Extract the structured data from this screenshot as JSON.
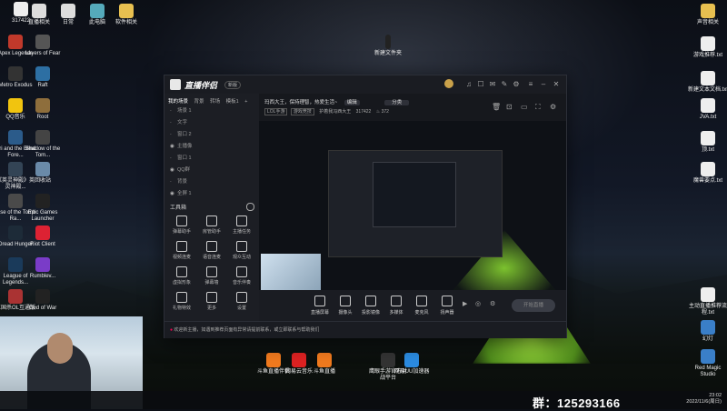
{
  "desktop": {
    "top_left_number": "317422",
    "left_icons": [
      {
        "label": "Apex Legends",
        "color": "#c0392b"
      },
      {
        "label": "Layers of Fear",
        "color": "#555"
      },
      {
        "label": "Metro Exodus",
        "color": "#333"
      },
      {
        "label": "Raft",
        "color": "#2d6fa3"
      },
      {
        "label": "QQ音乐",
        "color": "#f1c40f"
      },
      {
        "label": "Root",
        "color": "#8e6e3c"
      },
      {
        "label": "Ori and the Blind Fore...",
        "color": "#2b5b8a"
      },
      {
        "label": "Shadow of the Tom...",
        "color": "#444"
      },
      {
        "label": "《英灵神殿》英灵神殿...",
        "color": "#345"
      },
      {
        "label": "回收站",
        "color": "#6a8aa8"
      },
      {
        "label": "Rise of the Tomb Ra...",
        "color": "#4a4a4a"
      },
      {
        "label": "Epic Games Launcher",
        "color": "#222"
      },
      {
        "label": "Dread Hunger",
        "color": "#1d2b38"
      },
      {
        "label": "Riot Client",
        "color": "#d23"
      },
      {
        "label": "League of Legends...",
        "color": "#1a3a5a"
      },
      {
        "label": "Rumblev...",
        "color": "#7a3cc8"
      },
      {
        "label": "三国杀OL互通版",
        "color": "#a33"
      },
      {
        "label": "God of War",
        "color": "#222"
      }
    ],
    "top_icons": [
      {
        "label": "直播相关",
        "color": "#ddd"
      },
      {
        "label": "日常",
        "color": "#ddd"
      },
      {
        "label": "此电脑",
        "color": "#5ab"
      },
      {
        "label": "软件相关",
        "color": "#e8c050"
      }
    ],
    "top_center_label": "新建文件夹",
    "right_icons": [
      {
        "label": "声音相关",
        "color": "#e8c050"
      },
      {
        "label": "游戏推荐.txt",
        "color": "#eee"
      },
      {
        "label": "新建文本文档.txt",
        "color": "#eee"
      },
      {
        "label": "JVA.txt",
        "color": "#eee"
      },
      {
        "label": "顶.txt",
        "color": "#eee"
      },
      {
        "label": "魔兽要点.txt",
        "color": "#eee"
      },
      {
        "label": "主动直播推荐流程.txt",
        "color": "#eee"
      },
      {
        "label": "幻灯",
        "color": "#3a7fc8"
      },
      {
        "label": "Red Magic Studio",
        "color": "#3a7fc8"
      }
    ],
    "bottom_icons": [
      {
        "label": "斗鱼直播伴侣",
        "color": "#f07a1e"
      },
      {
        "label": "网易云音乐",
        "color": "#d22"
      },
      {
        "label": "斗鱼直播",
        "color": "#f07a1e"
      },
      {
        "label": "鹰眼手游官方对战平台",
        "color": "#333"
      },
      {
        "label": "网易UU加速器",
        "color": "#2b8be0"
      }
    ]
  },
  "app": {
    "title": "直播伴侣",
    "badge": "新版",
    "sidebar_tabs": [
      "我的场景",
      "背景",
      "转场",
      "模板1"
    ],
    "scenes": [
      {
        "label": "场景 1",
        "visible": false
      },
      {
        "label": "文字",
        "visible": false
      },
      {
        "label": "窗口 2",
        "visible": false
      },
      {
        "label": "主播像",
        "visible": true
      },
      {
        "label": "窗口 1",
        "visible": false
      },
      {
        "label": "QQ群",
        "visible": true
      },
      {
        "label": "背景",
        "visible": false
      },
      {
        "label": "全屏 1",
        "visible": true
      }
    ],
    "tools_title": "工具箱",
    "tools": [
      {
        "label": "弹幕助手"
      },
      {
        "label": "房管助手"
      },
      {
        "label": "主播任务"
      },
      {
        "label": "视频连麦"
      },
      {
        "label": "语音连麦"
      },
      {
        "label": "观众互动"
      },
      {
        "label": "虚拟形象"
      },
      {
        "label": "弹幕墙"
      },
      {
        "label": "音乐伴奏"
      },
      {
        "label": "礼物特效"
      },
      {
        "label": "更多"
      },
      {
        "label": "设置"
      }
    ],
    "header_room": "玛西大王，保持理智，热爱生活~",
    "header_btn1": "编辑",
    "header_btn2": "分类",
    "sub_category": "LOL手游",
    "sub_tag": "游戏竞技",
    "room_name": "护着我冯西大王",
    "room_id": "317422",
    "viewer_count": "372",
    "controls": [
      {
        "label": "直播屏幕"
      },
      {
        "label": "摄像头"
      },
      {
        "label": "投影镜像"
      },
      {
        "label": "多媒体"
      },
      {
        "label": "麦克风"
      },
      {
        "label": "扬声器"
      }
    ],
    "start_button": "开始直播",
    "status_text": "欢迎新主播，如遇到推荐页面有异常请提前联系，或立即联系与帮助我们"
  },
  "taskbar": {
    "group_text": "群：125293166",
    "time": "23:02",
    "date": "2022/11/6(周日)"
  }
}
